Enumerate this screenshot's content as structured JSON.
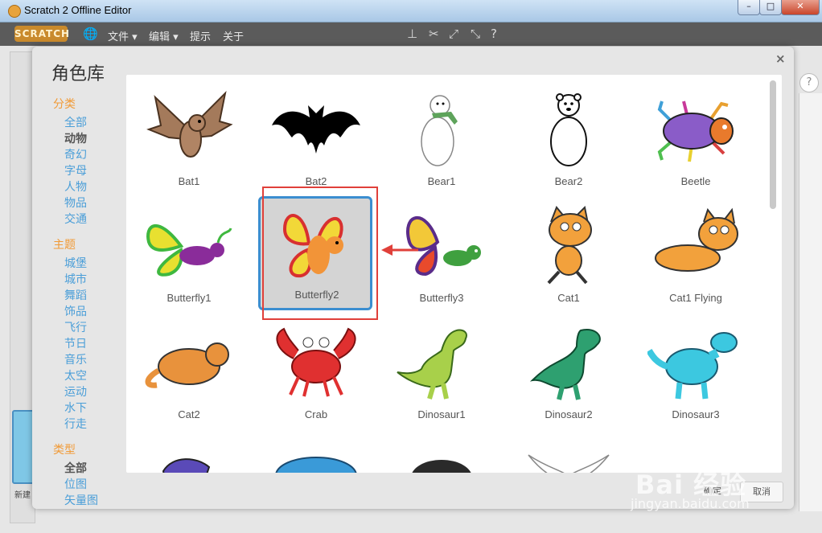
{
  "window": {
    "title": "Scratch 2 Offline Editor",
    "minimize": "–",
    "maximize": "□",
    "close": "✕"
  },
  "menubar": {
    "logo": "SCRATCH",
    "items": [
      {
        "label": "文件 ▾"
      },
      {
        "label": "编辑 ▾"
      },
      {
        "label": "提示"
      },
      {
        "label": "关于"
      }
    ]
  },
  "dialog": {
    "title": "角色库",
    "close": "×",
    "category_heading": "分类",
    "categories": [
      "全部",
      "动物",
      "奇幻",
      "字母",
      "人物",
      "物品",
      "交通"
    ],
    "selected_category": "动物",
    "theme_heading": "主题",
    "themes": [
      "城堡",
      "城市",
      "舞蹈",
      "饰品",
      "飞行",
      "节日",
      "音乐",
      "太空",
      "运动",
      "水下",
      "行走"
    ],
    "type_heading": "类型",
    "types": [
      "全部",
      "位图",
      "矢量图"
    ],
    "selected_type": "全部",
    "ok_label": "确定",
    "cancel_label": "取消"
  },
  "sprites": [
    {
      "name": "Bat1"
    },
    {
      "name": "Bat2"
    },
    {
      "name": "Bear1"
    },
    {
      "name": "Bear2"
    },
    {
      "name": "Beetle"
    },
    {
      "name": "Butterfly1"
    },
    {
      "name": "Butterfly2"
    },
    {
      "name": "Butterfly3"
    },
    {
      "name": "Cat1"
    },
    {
      "name": "Cat1 Flying"
    },
    {
      "name": "Cat2"
    },
    {
      "name": "Crab"
    },
    {
      "name": "Dinosaur1"
    },
    {
      "name": "Dinosaur2"
    },
    {
      "name": "Dinosaur3"
    }
  ],
  "selected_sprite": "Butterfly2",
  "editor": {
    "new_label": "新建",
    "help": "?"
  },
  "watermark": {
    "brand": "Bai 经验",
    "url": "jingyan.baidu.com"
  },
  "colors": {
    "accent": "#3b8ed0",
    "category_heading": "#f19a36",
    "link": "#4a9ed8",
    "annotation": "#e0403a"
  }
}
